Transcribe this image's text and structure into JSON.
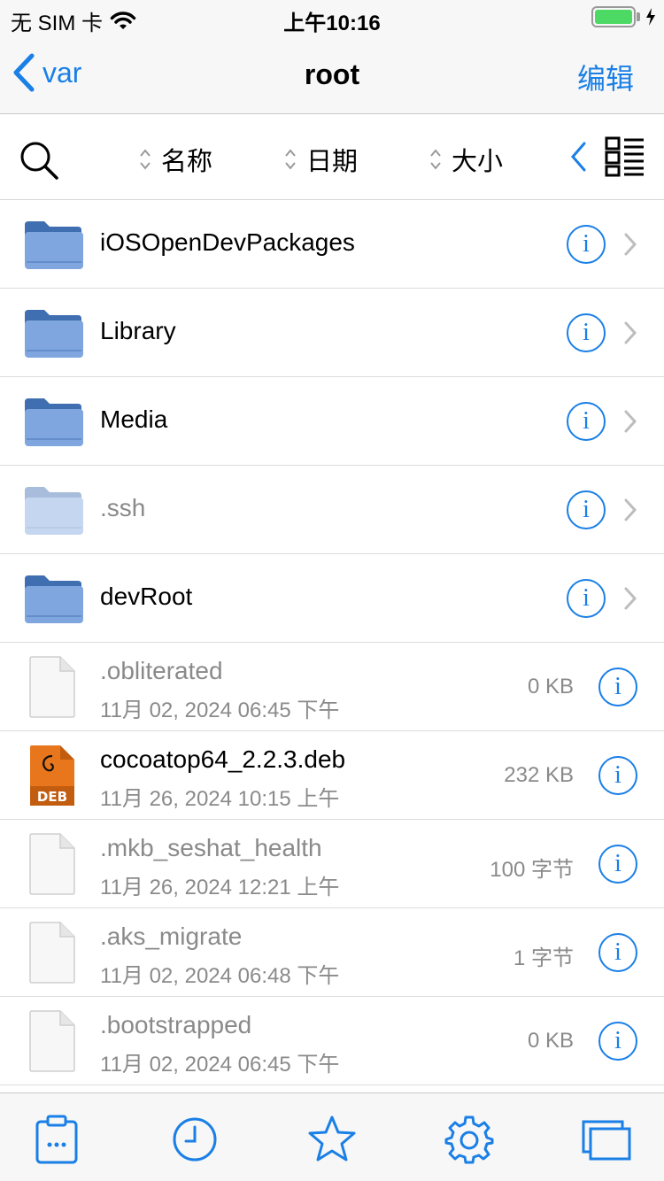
{
  "status_bar": {
    "carrier": "无 SIM 卡",
    "time": "上午10:16",
    "battery_level": 1.0,
    "battery_color": "#4cd964"
  },
  "nav": {
    "back_label": "var",
    "title": "root",
    "edit_label": "编辑",
    "accent": "#1a7fe6"
  },
  "sort_bar": {
    "search_icon": "search-icon",
    "columns": [
      "名称",
      "日期",
      "大小"
    ],
    "view_icon": "list-view-icon"
  },
  "items": [
    {
      "type": "folder",
      "name": "iOSOpenDevPackages",
      "dim": false
    },
    {
      "type": "folder",
      "name": "Library",
      "dim": false
    },
    {
      "type": "folder",
      "name": "Media",
      "dim": false
    },
    {
      "type": "folder",
      "name": ".ssh",
      "dim": true
    },
    {
      "type": "folder",
      "name": "devRoot",
      "dim": false
    },
    {
      "type": "file",
      "name": ".obliterated",
      "date": "11月 02, 2024 06:45 下午",
      "size": "0 KB",
      "dim": true,
      "icon": "document-icon"
    },
    {
      "type": "file",
      "name": "cocoatop64_2.2.3.deb",
      "date": "11月 26, 2024 10:15 上午",
      "size": "232 KB",
      "dim": false,
      "icon": "deb-package-icon"
    },
    {
      "type": "file",
      "name": ".mkb_seshat_health",
      "date": "11月 26, 2024 12:21 上午",
      "size": "100 字节",
      "dim": true,
      "icon": "document-icon"
    },
    {
      "type": "file",
      "name": ".aks_migrate",
      "date": "11月 02, 2024 06:48 下午",
      "size": "1 字节",
      "dim": true,
      "icon": "document-icon"
    },
    {
      "type": "file",
      "name": ".bootstrapped",
      "date": "11月 02, 2024 06:45 下午",
      "size": "0 KB",
      "dim": true,
      "icon": "document-icon"
    }
  ],
  "tab_bar": {
    "tabs": [
      "clipboard-icon",
      "clock-icon",
      "star-icon",
      "gear-icon",
      "windows-icon"
    ]
  }
}
